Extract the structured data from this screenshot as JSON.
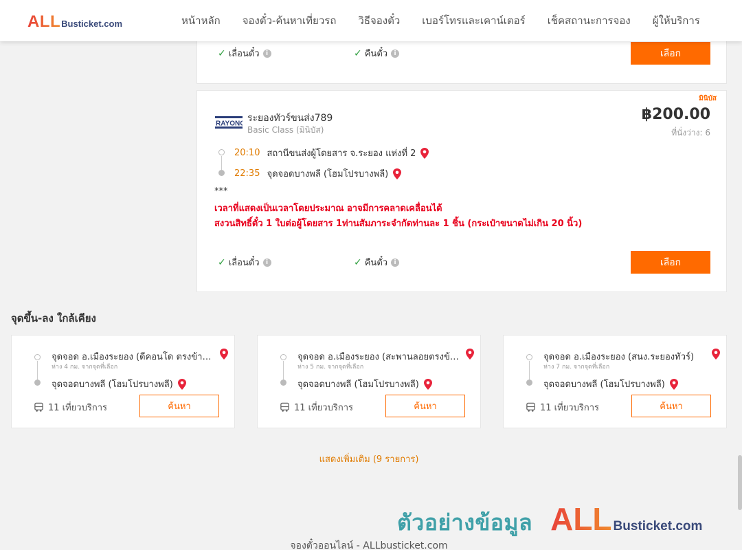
{
  "brand": {
    "logo_main": "ALL",
    "logo_domain": "Busticket.com"
  },
  "nav": {
    "items": [
      {
        "label": "หน้าหลัก"
      },
      {
        "label": "จองตั๋ว-ค้นหาเที่ยวรถ"
      },
      {
        "label": "วิธีจองตั๋ว"
      },
      {
        "label": "เบอร์โทรและเคาน์เตอร์"
      },
      {
        "label": "เช็คสถานะการจอง"
      },
      {
        "label": "ผู้ให้บริการ"
      }
    ]
  },
  "card_top": {
    "feature_change": "เลื่อนตั๋ว",
    "feature_refund": "คืนตั๋ว",
    "select_label": "เลือก"
  },
  "card_main": {
    "type_badge": "มินิบัส",
    "operator_name": "ระยองทัวร์ขนส่ง789",
    "operator_class": "Basic Class (มินิบัส)",
    "price": "฿200.00",
    "seats_left": "ที่นั่งว่าง: 6",
    "depart_time": "20:10",
    "depart_place": "สถานีขนส่งผู้โดยสาร จ.ระยอง แห่งที่ 2",
    "arrive_time": "22:35",
    "arrive_place": "จุดจอดบางพลี (โฮมโปรบางพลี)",
    "note_stars": "***",
    "note_line1": "เวลาที่แสดงเป็นเวลาโดยประมาณ อาจมีการคลาดเคลื่อนได้",
    "note_line2": "สงวนสิทธิ์ตั๋ว 1 ใบต่อผู้โดยสาร 1ท่านสัมภาระจำกัดท่านละ 1 ชิ้น (กระเป๋าขนาดไม่เกิน 20 นิ้ว)",
    "feature_change": "เลื่อนตั๋ว",
    "feature_refund": "คืนตั๋ว",
    "select_label": "เลือก"
  },
  "nearby": {
    "title": "จุดขึ้น-ลง ใกล้เคียง",
    "items": [
      {
        "from": "จุดจอด อ.เมืองระยอง (ดีคอนโด ตรงข้ามมหาวิทยาลัย)",
        "distance": "ห่าง 4 กม. จากจุดที่เลือก",
        "to": "จุดจอดบางพลี (โฮมโปรบางพลี)",
        "trips": "11 เที่ยวบริการ",
        "search_label": "ค้นหา"
      },
      {
        "from": "จุดจอด อ.เมืองระยอง (สะพานลอยตรงข้ามตลาด)",
        "distance": "ห่าง 5 กม. จากจุดที่เลือก",
        "to": "จุดจอดบางพลี (โฮมโปรบางพลี)",
        "trips": "11 เที่ยวบริการ",
        "search_label": "ค้นหา"
      },
      {
        "from": "จุดจอด อ.เมืองระยอง (สนง.ระยองทัวร์)",
        "distance": "ห่าง 7 กม. จากจุดที่เลือก",
        "to": "จุดจอดบางพลี (โฮมโปรบางพลี)",
        "trips": "11 เที่ยวบริการ",
        "search_label": "ค้นหา"
      }
    ],
    "show_more": "แสดงเพิ่มเติม (9 รายการ)"
  },
  "watermark": {
    "text": "ตัวอย่างข้อมูล",
    "logo_main": "ALL",
    "logo_domain": "Busticket.com"
  },
  "footer": {
    "text": "จองตั๋วออนไลน์ - ALLbusticket.com"
  },
  "colors": {
    "accent": "#ff6a00",
    "time": "#e07b00",
    "warning": "#e8001c",
    "check": "#2e9e3e"
  }
}
